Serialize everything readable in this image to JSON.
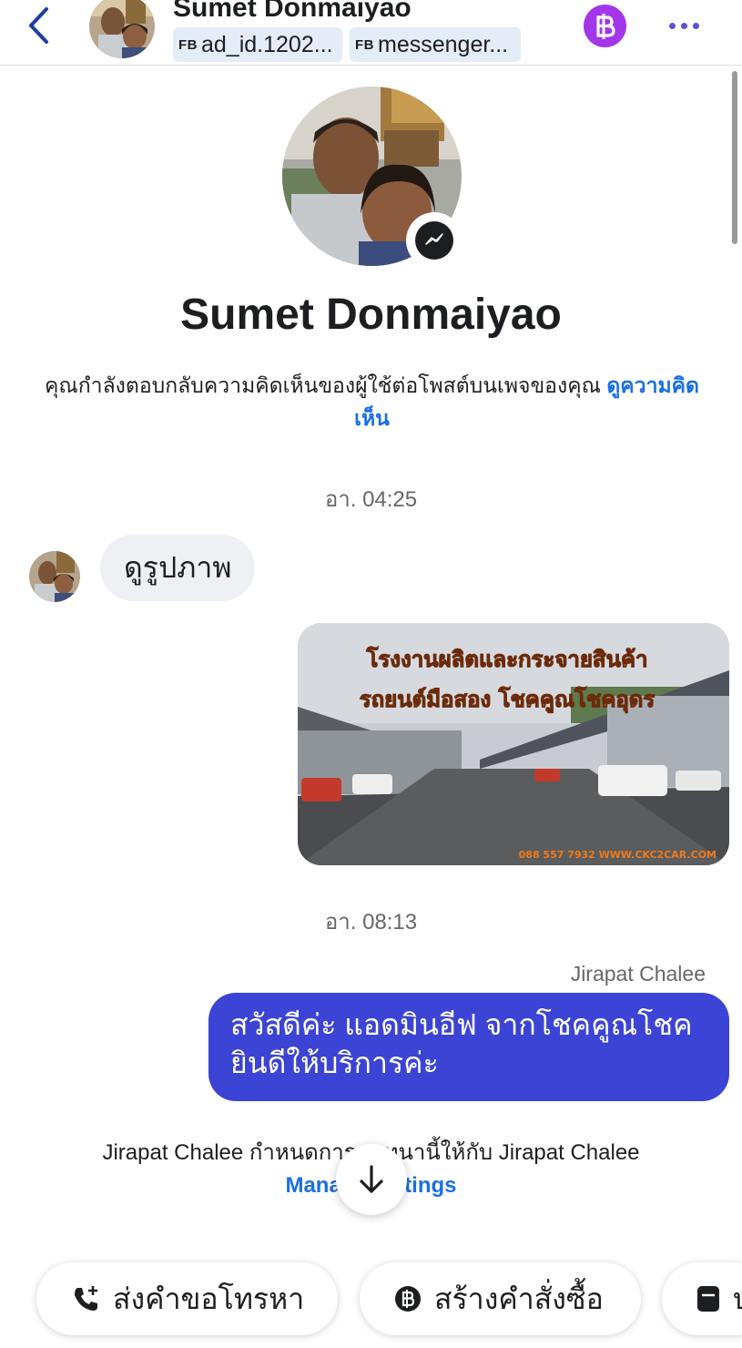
{
  "header": {
    "name": "Sumet Donmaiyao",
    "tags": [
      {
        "prefix": "FB",
        "label": "ad_id.1202..."
      },
      {
        "prefix": "FB",
        "label": "messenger..."
      }
    ]
  },
  "profile": {
    "name": "Sumet Donmaiyao",
    "context_text": "คุณกำลังตอบกลับความคิดเห็นของผู้ใช้ต่อโพสต์บนเพจของคุณ",
    "context_link": "ดูความคิดเห็น"
  },
  "conversation": {
    "timestamp_1": "อา. 04:25",
    "incoming_message": "ดูรูปภาพ",
    "image_banner_line1": "โรงงานผลิตและกระจายสินค้า",
    "image_banner_line2": "รถยนต์มือสอง โชคคูณโชคอุดร",
    "image_footer": "088 557 7932 WWW.CKC2CAR.COM",
    "timestamp_2": "อา. 08:13",
    "sender_name": "Jirapat Chalee",
    "outgoing_message": "สวัสดีค่ะ แอดมินอีฟ จากโชคคูณโชค ยินดีให้บริการค่ะ",
    "assignment_text": "Jirapat Chalee กำหนดการสนทนานี้ให้กับ Jirapat Chalee",
    "manage_link": "Manage settings"
  },
  "actions": [
    {
      "label": "ส่งคำขอโทรหา",
      "icon": "phone-plus-icon"
    },
    {
      "label": "สร้างคำสั่งซื้อ",
      "icon": "baht-icon"
    },
    {
      "label": "บ",
      "icon": "note-icon"
    }
  ],
  "colors": {
    "accent": "#3b44d4",
    "link": "#1a6ee8",
    "baht_button": "#a236e8"
  }
}
